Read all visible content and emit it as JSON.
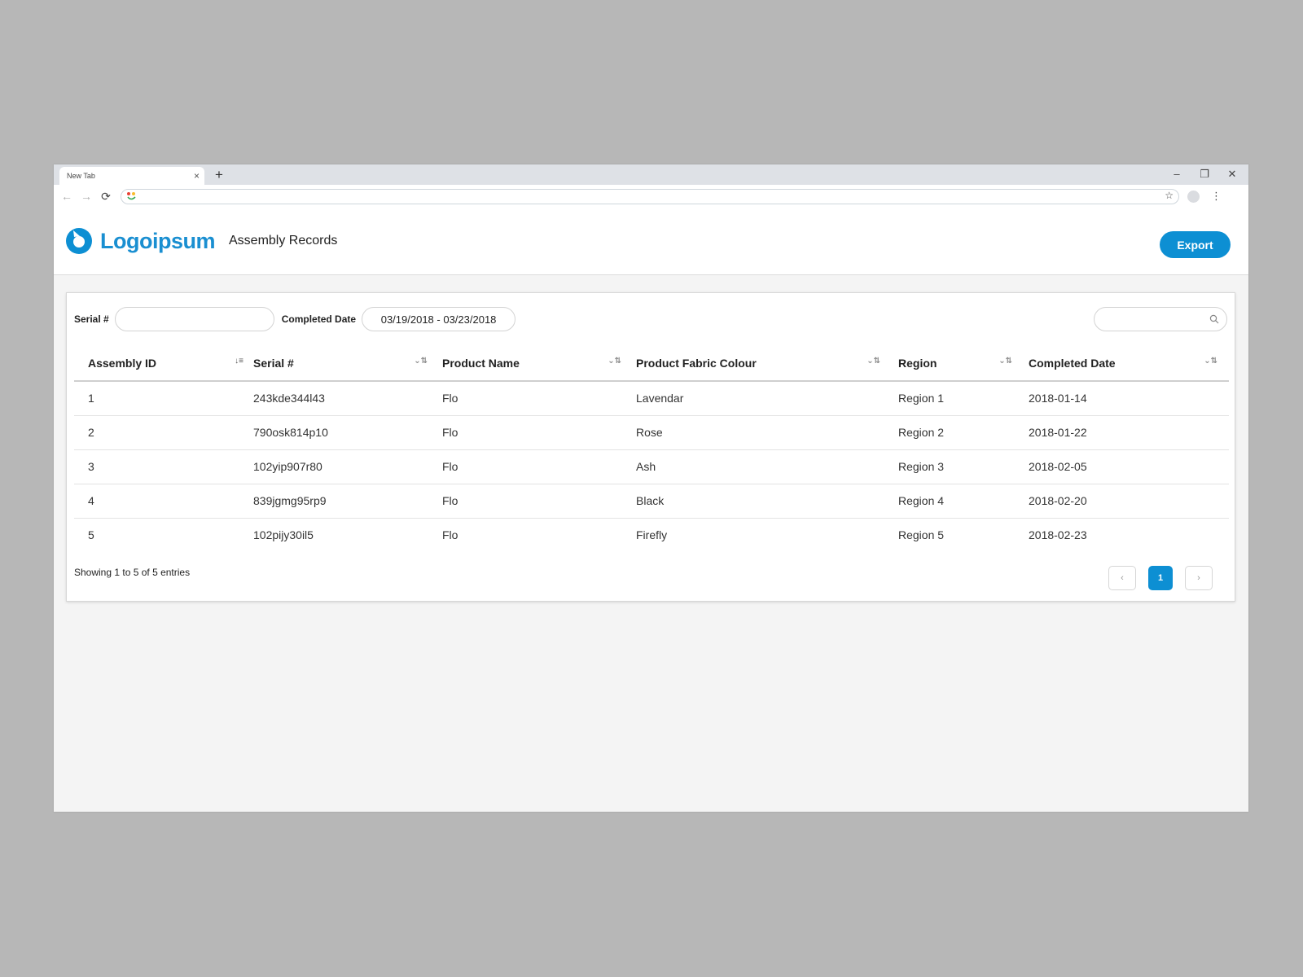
{
  "browser": {
    "tab_title": "New Tab",
    "tab_close": "×",
    "new_tab": "+",
    "minimize": "–",
    "restore": "❐",
    "close": "✕",
    "back": "←",
    "forward": "→",
    "reload": "⟳",
    "star": "☆",
    "menu": "⋮",
    "address_value": ""
  },
  "header": {
    "logo_text": "Logoipsum",
    "page_title": "Assembly Records",
    "export_label": "Export",
    "brand_color": "#0d8fd3"
  },
  "filters": {
    "serial_label": "Serial #",
    "serial_value": "",
    "date_label": "Completed Date",
    "date_value": "03/19/2018 - 03/23/2018",
    "search_value": ""
  },
  "table": {
    "columns": [
      "Assembly ID",
      "Serial #",
      "Product Name",
      "Product Fabric Colour",
      "Region",
      "Completed Date"
    ],
    "rows": [
      [
        "1",
        "243kde344l43",
        "Flo",
        "Lavendar",
        "Region 1",
        "2018-01-14"
      ],
      [
        "2",
        "790osk814p10",
        "Flo",
        "Rose",
        "Region 2",
        "2018-01-22"
      ],
      [
        "3",
        "102yip907r80",
        "Flo",
        "Ash",
        "Region 3",
        "2018-02-05"
      ],
      [
        "4",
        "839jgmg95rp9",
        "Flo",
        "Black",
        "Region 4",
        "2018-02-20"
      ],
      [
        "5",
        "102pijy30il5",
        "Flo",
        "Firefly",
        "Region 5",
        "2018-02-23"
      ]
    ]
  },
  "footer": {
    "info": "Showing 1 to 5 of 5 entries",
    "prev": "‹",
    "current_page": "1",
    "next": "›"
  }
}
